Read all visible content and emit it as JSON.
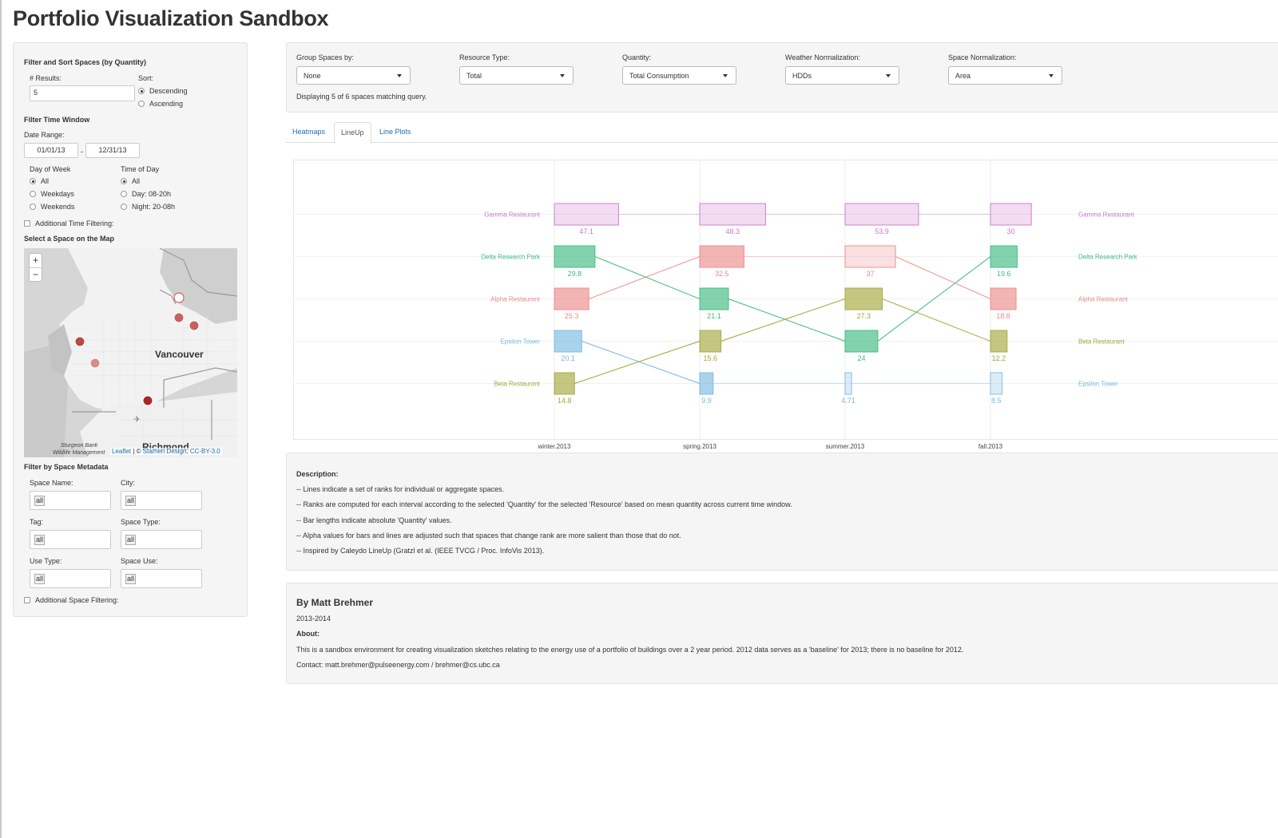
{
  "page": {
    "title": "Portfolio Visualization Sandbox"
  },
  "sidebar": {
    "filter_sort_title": "Filter and Sort Spaces (by Quantity)",
    "results_label": "# Results:",
    "results_value": "5",
    "sort_label": "Sort:",
    "sort_options": [
      {
        "label": "Descending",
        "checked": true
      },
      {
        "label": "Ascending",
        "checked": false
      }
    ],
    "time_window_title": "Filter Time Window",
    "date_range_label": "Date Range:",
    "date_start": "01/01/13",
    "date_sep": "-",
    "date_end": "12/31/13",
    "day_of_week_label": "Day of Week",
    "day_of_week_options": [
      {
        "label": "All",
        "checked": true
      },
      {
        "label": "Weekdays",
        "checked": false
      },
      {
        "label": "Weekends",
        "checked": false
      }
    ],
    "time_of_day_label": "Time of Day",
    "time_of_day_options": [
      {
        "label": "All",
        "checked": true
      },
      {
        "label": "Day: 08-20h",
        "checked": false
      },
      {
        "label": "Night: 20-08h",
        "checked": false
      }
    ],
    "additional_time_label": "Additional Time Filtering:",
    "map_title": "Select a Space on the Map",
    "map": {
      "zoom_in": "+",
      "zoom_out": "−",
      "city_label": "Vancouver",
      "city2_label": "Richmond",
      "place_label_1": "Sturgeon Bank",
      "place_label_2": "Wildlife Management",
      "attribution_link": "Leaflet",
      "attribution_sep": " | © ",
      "attribution_text": "Stamen Design, CC-BY-3.0"
    },
    "metadata_title": "Filter by Space Metadata",
    "metadata_fields": [
      {
        "label": "Space Name:",
        "value": "all"
      },
      {
        "label": "City:",
        "value": "all"
      },
      {
        "label": "Tag:",
        "value": "all"
      },
      {
        "label": "Space Type:",
        "value": "all"
      },
      {
        "label": "Use Type:",
        "value": "all"
      },
      {
        "label": "Space Use:",
        "value": "all"
      }
    ],
    "additional_space_label": "Additional Space Filtering:"
  },
  "controls": {
    "dropdowns": [
      {
        "label": "Group Spaces by:",
        "value": "None"
      },
      {
        "label": "Resource Type:",
        "value": "Total"
      },
      {
        "label": "Quantity:",
        "value": "Total Consumption"
      },
      {
        "label": "Weather Normalization:",
        "value": "HDDs"
      },
      {
        "label": "Space Normalization:",
        "value": "Area"
      }
    ],
    "status": "Displaying 5 of 6 spaces matching query."
  },
  "tabs": [
    {
      "label": "Heatmaps",
      "active": false
    },
    {
      "label": "LineUp",
      "active": true
    },
    {
      "label": "Line Plots",
      "active": false
    }
  ],
  "chart_data": {
    "type": "bar",
    "subtype": "lineup-rank",
    "periods": [
      "winter.2013",
      "spring.2013",
      "summer.2013",
      "fall.2013"
    ],
    "series": [
      {
        "name": "Gamma Restaurant",
        "color": "#c978c9",
        "values": [
          47.1,
          48.3,
          53.9,
          30
        ],
        "labels": [
          "47.1",
          "48.3",
          "53.9",
          "30"
        ],
        "ranks": [
          1,
          1,
          1,
          1
        ]
      },
      {
        "name": "Delta Research Park",
        "color": "#3cba7f",
        "values": [
          29.8,
          21.1,
          24,
          19.6
        ],
        "labels": [
          "29.8",
          "21.1",
          "24",
          "19.6"
        ],
        "ranks": [
          2,
          3,
          4,
          2
        ]
      },
      {
        "name": "Alpha Restaurant",
        "color": "#ec8a8a",
        "values": [
          25.3,
          32.5,
          37,
          18.8
        ],
        "labels": [
          "25.3",
          "32.5",
          "37",
          "18.8"
        ],
        "ranks": [
          3,
          2,
          2,
          3
        ]
      },
      {
        "name": "Epsilon Tower",
        "color": "#7ab8e0",
        "values": [
          20.1,
          9.9,
          4.71,
          8.5
        ],
        "labels": [
          "20.1",
          "9.9",
          "4.71",
          "8.5"
        ],
        "ranks": [
          4,
          5,
          5,
          5
        ]
      },
      {
        "name": "Beta Restaurant",
        "color": "#a3a63a",
        "values": [
          14.8,
          15.6,
          27.3,
          12.2
        ],
        "labels": [
          "14.8",
          "15.6",
          "27.3",
          "12.2"
        ],
        "ranks": [
          5,
          4,
          3,
          4
        ]
      }
    ],
    "left_labels": [
      "Gamma Restaurant",
      "Delta Research Park",
      "Alpha Restaurant",
      "Epsilon Tower",
      "Beta Restaurant"
    ],
    "right_labels": [
      "Gamma Restaurant",
      "Delta Research Park",
      "Alpha Restaurant",
      "Beta Restaurant",
      "Epsilon Tower"
    ],
    "grid": true
  },
  "description": {
    "title": "Description:",
    "lines": [
      "-- Lines indicate a set of ranks for individual or aggregate spaces.",
      "-- Ranks are computed for each interval according to the selected 'Quantity' for the selected 'Resource' based on mean quantity across current time window.",
      "-- Bar lengths indicate absolute 'Quantity' values.",
      "-- Alpha values for bars and lines are adjusted such that spaces that change rank are more salient than those that do not.",
      "-- Inspired by Caleydo LineUp (Gratzl et al. (IEEE TVCG / Proc. InfoVis 2013)."
    ]
  },
  "about": {
    "author": "By Matt Brehmer",
    "years": "2013-2014",
    "about_label": "About:",
    "about_text": "This is a sandbox environment for creating visualization sketches relating to the energy use of a portfolio of buildings over a 2 year period. 2012 data serves as a 'baseline' for 2013; there is no baseline for 2012.",
    "contact": "Contact: matt.brehmer@pulseenergy.com / brehmer@cs.ubc.ca"
  }
}
